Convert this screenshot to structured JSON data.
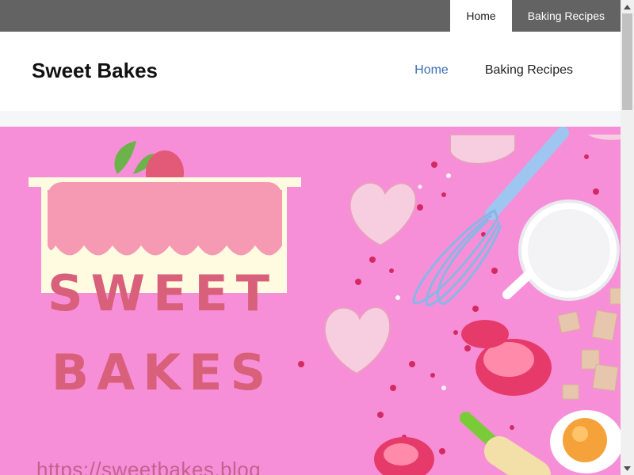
{
  "top_nav": {
    "items": [
      {
        "label": "Home",
        "active": true
      },
      {
        "label": "Baking Recipes",
        "active": false
      }
    ]
  },
  "header": {
    "site_title": "Sweet Bakes",
    "nav": [
      {
        "label": "Home",
        "active": true
      },
      {
        "label": "Baking Recipes",
        "active": false
      }
    ]
  },
  "hero": {
    "logo_line1": "SWEET",
    "logo_line2": "BAKES",
    "url_text": "https://sweetbakes.blog",
    "icons": [
      "cake-icon",
      "whisk-icon",
      "heart-cookie-icon",
      "flour-cup-icon",
      "egg-icon",
      "rolling-pin-icon",
      "cupcake-liner-icon"
    ]
  },
  "colors": {
    "topbar": "#636363",
    "accent_link": "#3b6fb6",
    "hero_bg": "#f78fd8",
    "logo_text": "#d9607a"
  }
}
